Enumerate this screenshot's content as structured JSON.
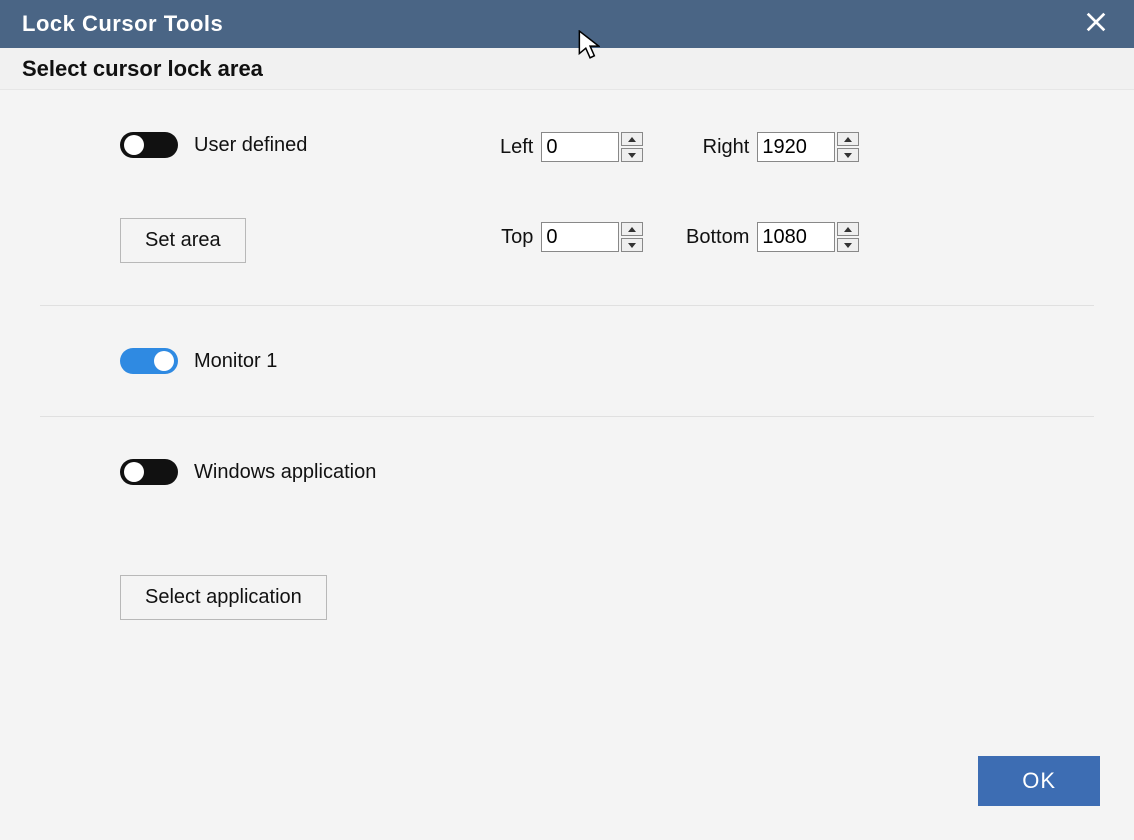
{
  "window": {
    "title": "Lock Cursor Tools",
    "subtitle": "Select cursor lock area"
  },
  "section_user_defined": {
    "toggle_label": "User defined",
    "toggle_on": false,
    "set_area_button": "Set area",
    "fields": {
      "left": {
        "label": "Left",
        "value": "0"
      },
      "right": {
        "label": "Right",
        "value": "1920"
      },
      "top": {
        "label": "Top",
        "value": "0"
      },
      "bottom": {
        "label": "Bottom",
        "value": "1080"
      }
    }
  },
  "section_monitor": {
    "toggle_label": "Monitor 1",
    "toggle_on": true
  },
  "section_windows_app": {
    "toggle_label": "Windows application",
    "toggle_on": false,
    "select_app_button": "Select application"
  },
  "footer": {
    "ok_button": "OK"
  }
}
